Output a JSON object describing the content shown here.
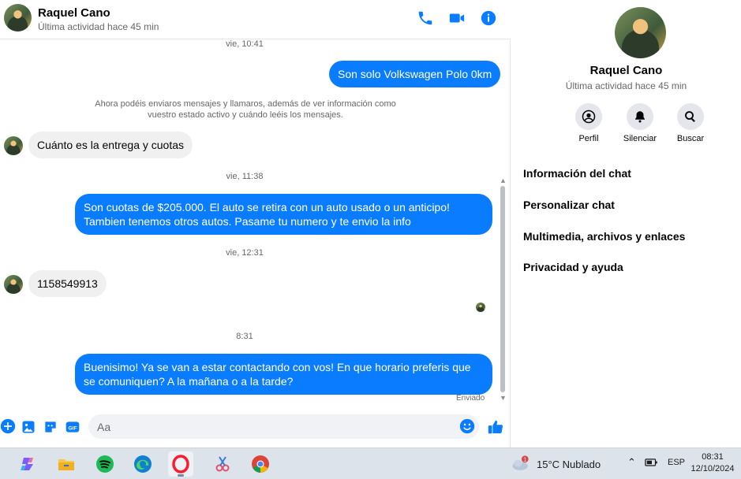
{
  "header": {
    "name": "Raquel Cano",
    "status": "Última actividad hace 45 min"
  },
  "messages": {
    "ts1": "vie, 10:41",
    "msg1": "Son solo Volkswagen Polo 0km",
    "system": "Ahora podéis enviaros mensajes y llamaros, además de ver información como vuestro estado activo y cuándo leéis los mensajes.",
    "msg2": "Cuánto es la entrega y cuotas",
    "ts2": "vie, 11:38",
    "msg3": "Son cuotas de $205.000. El auto se retira con un auto usado o un anticipo! Tambien tenemos otros autos. Pasame tu numero y te envio la info",
    "ts3": "vie, 12:31",
    "msg4": "1158549913",
    "ts4": "8:31",
    "msg5": "Buenisimo! Ya se van a estar contactando con vos! En que horario preferis que se comuniquen? A la mañana o a la tarde?",
    "sent_label": "Enviado"
  },
  "composer": {
    "placeholder": "Aa"
  },
  "info": {
    "name": "Raquel Cano",
    "status": "Última actividad hace 45 min",
    "actions": [
      {
        "label": "Perfil",
        "icon": "profile-icon"
      },
      {
        "label": "Silenciar",
        "icon": "bell-icon"
      },
      {
        "label": "Buscar",
        "icon": "search-icon"
      }
    ],
    "menu": [
      "Información del chat",
      "Personalizar chat",
      "Multimedia, archivos y enlaces",
      "Privacidad y ayuda"
    ]
  },
  "taskbar": {
    "weather_text": "15°C  Nublado",
    "weather_badge": "1",
    "language": "ESP",
    "time": "08:31",
    "date": "12/10/2024"
  },
  "colors": {
    "accent": "#0a7cff",
    "incoming_bubble": "#f0f0f0",
    "taskbar": "#dde3eb"
  }
}
